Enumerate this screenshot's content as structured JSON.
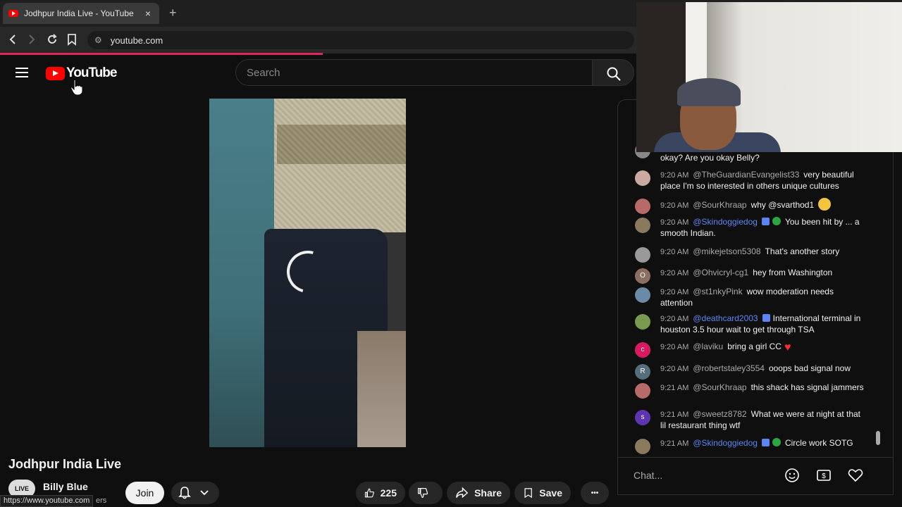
{
  "browser": {
    "tab_title": "Jodhpur India Live - YouTube",
    "tab_close": "×",
    "new_tab": "+",
    "url": "youtube.com",
    "status_url": "https://www.youtube.com"
  },
  "header": {
    "logo_text": "YouTube",
    "search_placeholder": "Search"
  },
  "video": {
    "title": "Jodhpur India Live",
    "channel_name": "Billy Blue",
    "channel_avatar_text": "LIVE",
    "subscribers_fragment": "ers",
    "join_label": "Join",
    "likes": "225",
    "share_label": "Share",
    "save_label": "Save",
    "more_label": "•••"
  },
  "chat": {
    "messages": [
      {
        "time": "",
        "author": "",
        "text": "okay? Are you okay Belly?",
        "avatar_color": "#888",
        "avatar_letter": ""
      },
      {
        "time": "9:20 AM",
        "author": "@TheGuardianEvangelist33",
        "text": "very beautiful place I'm so interested in others unique cultures",
        "avatar_color": "#c9a9a0",
        "avatar_letter": ""
      },
      {
        "time": "9:20 AM",
        "author": "@SourKhraap",
        "text": "why @svarthod1",
        "avatar_color": "#b86a6a",
        "avatar_letter": ""
      },
      {
        "time": "9:20 AM",
        "author": "@Skindoggiedog",
        "text": "You been hit by ... a smooth Indian.",
        "avatar_color": "#8a7a60",
        "avatar_letter": ""
      },
      {
        "time": "9:20 AM",
        "author": "@mikejetson5308",
        "text": "That's another story",
        "avatar_color": "#999",
        "avatar_letter": ""
      },
      {
        "time": "9:20 AM",
        "author": "@Ohvicryl-cg1",
        "text": "hey from Washington",
        "avatar_color": "#8d6e63",
        "avatar_letter": "O"
      },
      {
        "time": "9:20 AM",
        "author": "@st1nkyPink",
        "text": "wow moderation needs attention",
        "avatar_color": "#6a8aa8",
        "avatar_letter": ""
      },
      {
        "time": "9:20 AM",
        "author": "@deathcard2003",
        "text": "International terminal in houston 3.5 hour wait to get through TSA",
        "avatar_color": "#7a9a50",
        "avatar_letter": ""
      },
      {
        "time": "9:20 AM",
        "author": "@laviku",
        "text": "bring a girl CC",
        "avatar_color": "#d81b60",
        "avatar_letter": "c"
      },
      {
        "time": "9:20 AM",
        "author": "@robertstaley3554",
        "text": "ooops bad signal now",
        "avatar_color": "#546e7a",
        "avatar_letter": "R"
      },
      {
        "time": "9:21 AM",
        "author": "@SourKhraap",
        "text": "this shack has signal jammers",
        "avatar_color": "#b86a6a",
        "avatar_letter": ""
      },
      {
        "time": "9:21 AM",
        "author": "@sweetz8782",
        "text": "What we were at night at that lil restaurant thing wtf",
        "avatar_color": "#5e35b1",
        "avatar_letter": "s"
      },
      {
        "time": "9:21 AM",
        "author": "@Skindoggiedog",
        "text": "Circle work SOTG",
        "avatar_color": "#8a7a60",
        "avatar_letter": ""
      }
    ],
    "input_placeholder": "Chat..."
  },
  "colors": {
    "accent_red": "#ff0000",
    "mod_blue": "#5e84f1",
    "load_bar": "#e0245e"
  }
}
